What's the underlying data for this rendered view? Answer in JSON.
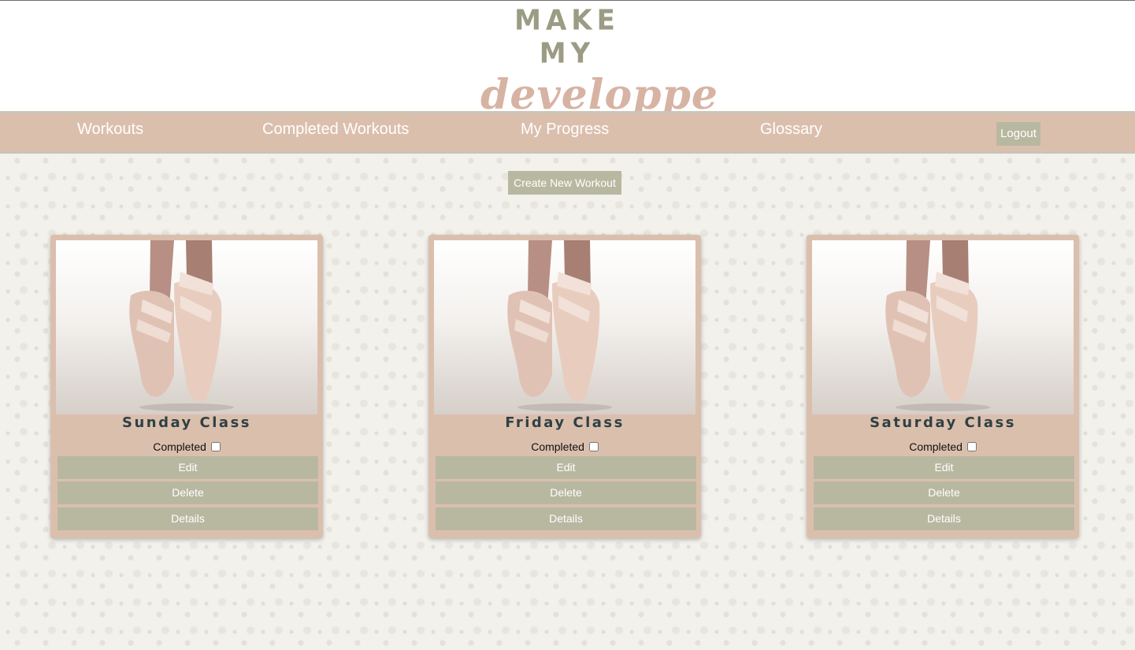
{
  "logo": {
    "line1": "MAKE MY",
    "line2": "developpe"
  },
  "nav": {
    "items": [
      "Workouts",
      "Completed Workouts",
      "My Progress",
      "Glossary"
    ],
    "logout_label": "Logout"
  },
  "create_label": "Create New Workout",
  "cards": [
    {
      "title": "Sunday Class",
      "completed_label": "Completed",
      "completed": false,
      "edit": "Edit",
      "delete": "Delete",
      "details": "Details",
      "image": "ballet-pointe-shoes-photo"
    },
    {
      "title": "Friday Class",
      "completed_label": "Completed",
      "completed": false,
      "edit": "Edit",
      "delete": "Delete",
      "details": "Details",
      "image": "ballet-pointe-shoes-photo"
    },
    {
      "title": "Saturday Class",
      "completed_label": "Completed",
      "completed": false,
      "edit": "Edit",
      "delete": "Delete",
      "details": "Details",
      "image": "ballet-pointe-shoes-photo"
    }
  ],
  "colors": {
    "nav_bg": "#dbbfad",
    "button_bg": "#b8b8a1",
    "title_text": "#2f4145",
    "logo_top": "#9c9c84",
    "logo_bottom": "#d7b3a3"
  }
}
